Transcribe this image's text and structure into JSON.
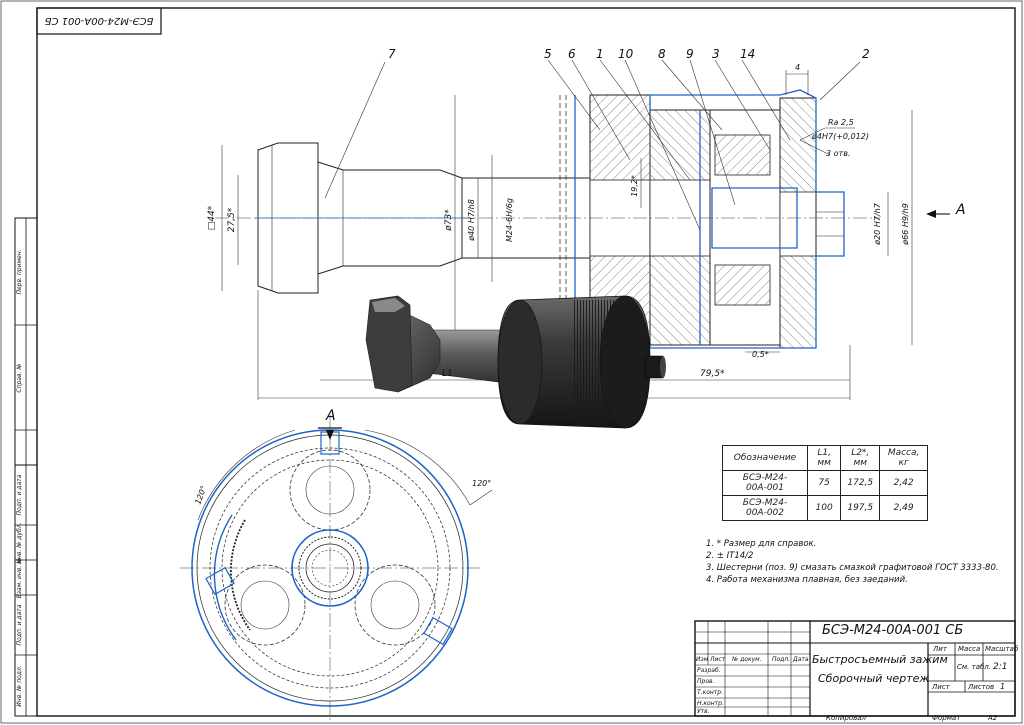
{
  "drawing": {
    "code": "БСЭ-М24-00А-001 СБ",
    "code_rotated": "БСЭ-М24-00А-001 СБ",
    "title_line1": "Быстросъемный зажим",
    "title_line2": "Сборочный чертеж",
    "mass_ref": "См. табл.",
    "scale": "2:1",
    "sheet_label": "Лист",
    "sheets_label": "Листов",
    "sheets_count": "1",
    "copied": "Копировал",
    "format_label": "Формат",
    "format": "А2"
  },
  "stamp_headers": {
    "lit": "Лит",
    "massa": "Масса",
    "masshtab": "Масштаб",
    "izm": "Изм",
    "list": "Лист",
    "n_dokum": "№ докум.",
    "podp": "Подп.",
    "data": "Дата",
    "razrab": "Разраб.",
    "prov": "Пров.",
    "tkontr": "Т.контр.",
    "nkontr": "Н.контр.",
    "utv": "Утв."
  },
  "side_stamp": [
    "Перв. примен.",
    "Справ. №",
    "Подп. и дата",
    "Инв. № дубл.",
    "Взам. инв. №",
    "Подп. и дата",
    "Инв. № подл."
  ],
  "positions": [
    "7",
    "5",
    "6",
    "1",
    "10",
    "8",
    "9",
    "3",
    "14",
    "2"
  ],
  "dimensions": {
    "d44": "□44*",
    "d275": "27,5*",
    "d73": "ø73*",
    "d40": "ø40 H7/h8",
    "m24": "M24-6H/6g",
    "d192": "19,2*",
    "d20": "ø20 H7/h7",
    "d66": "ø66 H9/h9",
    "ra": "Ra 2,5",
    "d4": "ø4H7(+0,012)",
    "holes": "3 отв.",
    "dim4": "4",
    "dim05": "0,5*",
    "dim795": "79,5*",
    "L1": "L1",
    "view_a": "A",
    "angle1": "120°",
    "angle2": "120°"
  },
  "table": {
    "headers": [
      "Обозначение",
      "L1, мм",
      "L2*, мм",
      "Масса, кг"
    ],
    "rows": [
      [
        "БСЭ-М24-00А-001",
        "75",
        "172,5",
        "2,42"
      ],
      [
        "БСЭ-М24-00А-002",
        "100",
        "197,5",
        "2,49"
      ]
    ]
  },
  "notes": [
    "1. * Размер для справок.",
    "2. ± IT14/2",
    "3. Шестерни (поз. 9) смазать смазкой графитовой ГОСТ 3333-80.",
    "4. Работа механизма плавная, без заеданий."
  ]
}
